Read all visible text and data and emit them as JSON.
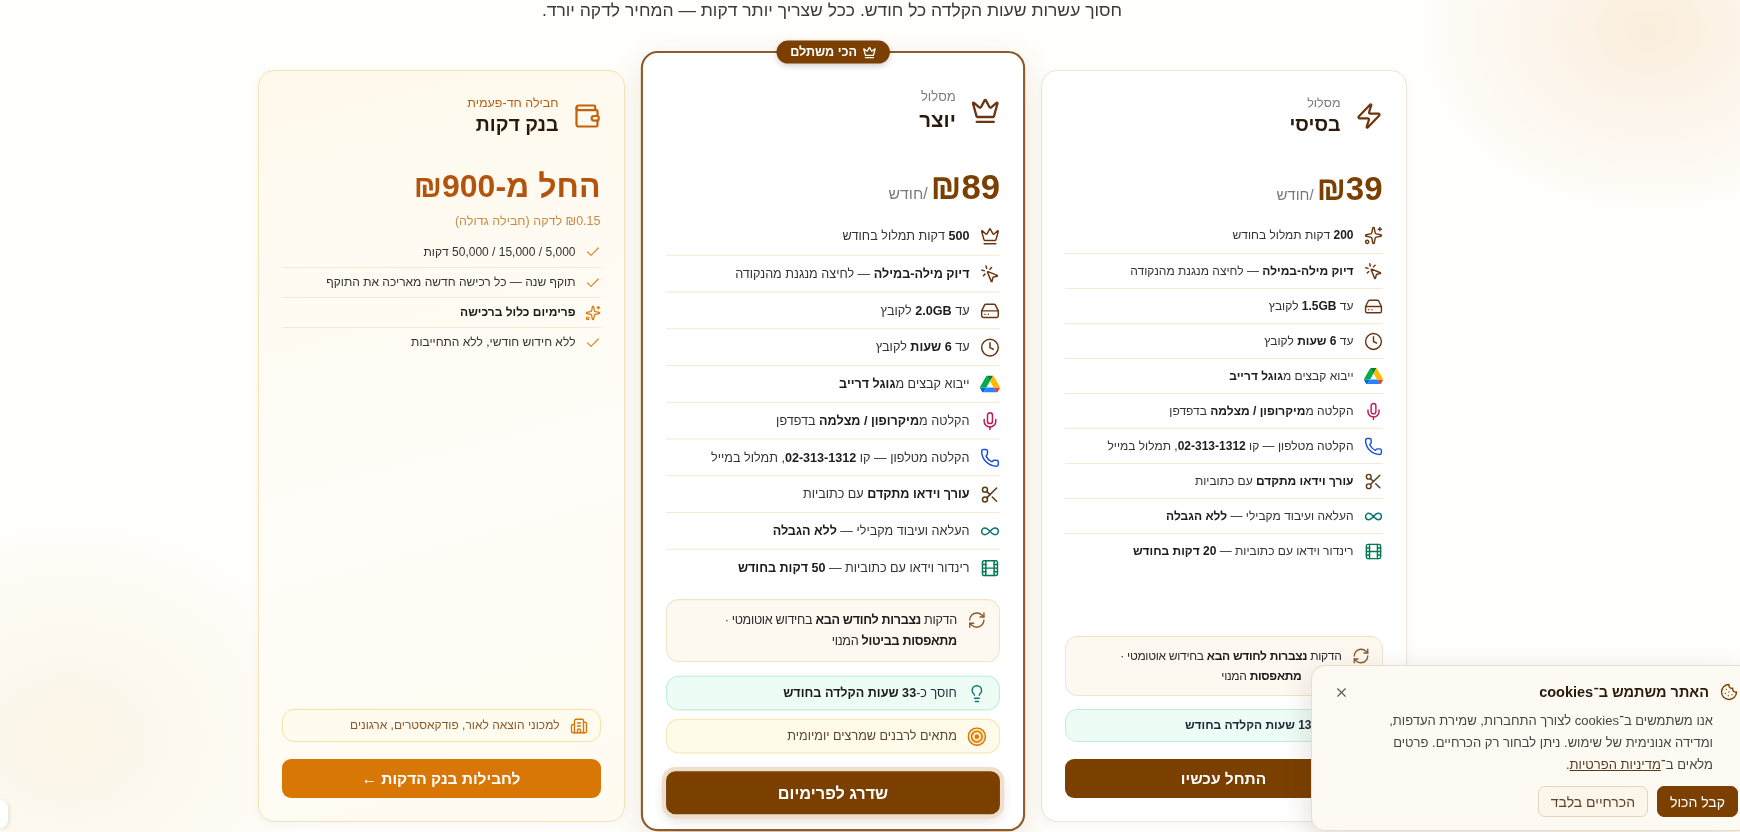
{
  "lead": "חסוך עשרות שעות הקלדה כל חודש. ככל שצריך יותר דקות — המחיר לדקה יורד.",
  "plans": [
    {
      "kind": "basic",
      "highlighted": false,
      "caption": "מסלול",
      "name": "בסיסי",
      "price": "₪39",
      "period": "/חודש",
      "features": [
        {
          "kind": "minutes",
          "text": "**200** דקות תמלול בחודש"
        },
        {
          "kind": "precision",
          "text": "**דיוק מילה-במילה** — לחיצה מנגנת מהנקודה"
        },
        {
          "kind": "size",
          "text": "עד **1.5GB** לקובץ"
        },
        {
          "kind": "duration",
          "text": "עד **6 שעות** לקובץ"
        },
        {
          "kind": "drive",
          "text": "ייבוא קבצים מ**גוגל דרייב**"
        },
        {
          "kind": "recording",
          "text": "הקלטה מ**מיקרופון / מצלמה** בדפדפן"
        },
        {
          "kind": "phone",
          "text": "הקלטה מטלפון — קו **02-313-1312**, תמלול במייל"
        },
        {
          "kind": "editor",
          "text": "**עורך וידאו מתקדם** עם כתוביות"
        },
        {
          "kind": "parallel",
          "text": "העלאה ועיבוד מקבילי — **ללא הגבלה**"
        },
        {
          "kind": "render",
          "text": "רינדור וידאו עם כתוביות — **20 דקות בחודש**"
        }
      ],
      "notes": [
        {
          "kind": "rollover",
          "text": "הדקות **נצברות לחודש הבא** בחידוש אוטומטי · **מתאפסות** המנוי",
          "bold": false,
          "under_banner": true
        },
        {
          "kind": "savings",
          "text": "13 שעות הקלדה בחודש",
          "bold": true,
          "under_banner": true
        }
      ],
      "button": "התחל עכשיו"
    },
    {
      "kind": "creator",
      "highlighted": true,
      "badge": "הכי משתלם",
      "caption": "מסלול",
      "name": "יוצר",
      "price": "₪89",
      "period": "/חודש",
      "features": [
        {
          "kind": "minutes",
          "text": "**500** דקות תמלול בחודש"
        },
        {
          "kind": "precision",
          "text": "**דיוק מילה-במילה** — לחיצה מנגנת מהנקודה"
        },
        {
          "kind": "size",
          "text": "עד **2.0GB** לקובץ"
        },
        {
          "kind": "duration",
          "text": "עד **6 שעות** לקובץ"
        },
        {
          "kind": "drive",
          "text": "ייבוא קבצים מ**גוגל דרייב**"
        },
        {
          "kind": "recording",
          "text": "הקלטה מ**מיקרופון / מצלמה** בדפדפן"
        },
        {
          "kind": "phone",
          "text": "הקלטה מטלפון — קו **02-313-1312**, תמלול במייל"
        },
        {
          "kind": "editor",
          "text": "**עורך וידאו מתקדם** עם כתוביות"
        },
        {
          "kind": "parallel",
          "text": "העלאה ועיבוד מקבילי — **ללא הגבלה**"
        },
        {
          "kind": "render",
          "text": "רינדור וידאו עם כתוביות — **50 דקות בחודש**"
        }
      ],
      "notes": [
        {
          "kind": "rollover",
          "text": "הדקות **נצברות לחודש הבא** בחידוש אוטומטי · **מתאפסות בביטול** המנוי",
          "bold": false,
          "under_banner": false
        },
        {
          "kind": "savings",
          "text": "חוסך כ-**33 שעות הקלדה בחודש**",
          "bold": false,
          "under_banner": false
        },
        {
          "kind": "audience",
          "text": "מתאים לרבנים שמרצים יומיומית",
          "bold": false,
          "under_banner": false
        }
      ],
      "button": "שדרג לפרימיום"
    },
    {
      "kind": "bank",
      "highlighted": false,
      "caption": "חבילה חד-פעמית",
      "name": "בנק דקות",
      "price": "החל מ-₪900",
      "price_note": "₪0.15 לדקה (חבילה גדולה)",
      "features": [
        {
          "kind": "check",
          "text": "5,000 / 15,000 / 50,000 דקות"
        },
        {
          "kind": "check",
          "text": "תוקף שנה — כל רכישה חדשה מאריכה את התוקף"
        },
        {
          "kind": "premium",
          "text": "פרימיום כלול ברכישה"
        },
        {
          "kind": "check",
          "text": "ללא חידוש חודשי, ללא התחייבות"
        }
      ],
      "notes": [
        {
          "kind": "info",
          "text": "למכוני הוצאה לאור, פודקאסטרים, ארגונים",
          "bold": false,
          "under_banner": false
        }
      ],
      "button": "לחבילות בנק הדקות ←"
    }
  ],
  "cookie_banner": {
    "title": "האתר משתמש ב־cookies",
    "text": "אנו משתמשים ב־cookies לצורך התחברות, שמירת העדפות, ומדידה אנונימית של שימוש. ניתן לבחור רק הכרחיים. פרטים מלאים ב־",
    "link": "מדיניות הפרטיות",
    "text_after": ".",
    "buttons": [
      {
        "kind": "primary",
        "label": "קבל הכול"
      },
      {
        "kind": "secondary",
        "label": "הכרחיים בלבד"
      }
    ]
  }
}
